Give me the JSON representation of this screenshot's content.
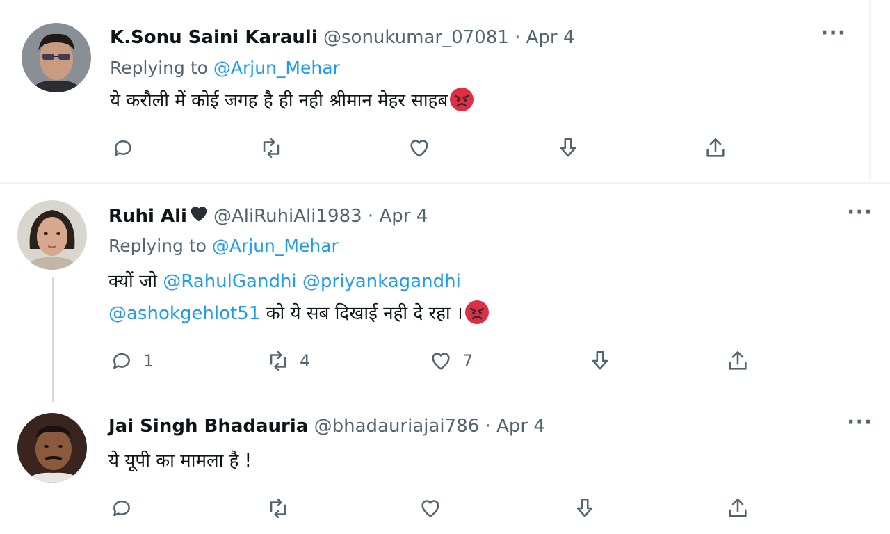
{
  "tweets": [
    {
      "name": "K.Sonu Saini Karauli",
      "handle": "@sonukumar_07081",
      "sep": " · ",
      "date": "Apr 4",
      "replying_prefix": "Replying to ",
      "replying_to": "@Arjun_Mehar",
      "text": "ये करौली में कोई जगह है ही नही श्रीमान मेहर साहब",
      "emoji": "angry-face-icon",
      "more": "···",
      "counts": {
        "reply": "",
        "retweet": "",
        "like": ""
      }
    },
    {
      "name": "Ruhi Ali",
      "name_emoji": "black-heart-icon",
      "handle": "@AliRuhiAli1983",
      "sep": " · ",
      "date": "Apr 4",
      "replying_prefix": "Replying to ",
      "replying_to": "@Arjun_Mehar",
      "text_line1_prefix": "क्यों जो ",
      "mention1": "@RahulGandhi",
      "mention2": "@priyankagandhi",
      "mention3": "@ashokgehlot51",
      "text_line2_suffix": " को ये सब दिखाई नही दे रहा ।",
      "emoji": "angry-face-icon",
      "more": "···",
      "counts": {
        "reply": "1",
        "retweet": "4",
        "like": "7"
      }
    },
    {
      "name": "Jai Singh Bhadauria",
      "handle": "@bhadauriajai786",
      "sep": " · ",
      "date": "Apr 4",
      "text": "ये यूपी का मामला है !",
      "more": "···",
      "counts": {
        "reply": "",
        "retweet": "",
        "like": ""
      }
    }
  ],
  "colors": {
    "accent": "#1d9bf0",
    "muted": "#536471",
    "text": "#0f1419",
    "thread_line": "#cfd9de",
    "divider": "#eff3f4"
  }
}
